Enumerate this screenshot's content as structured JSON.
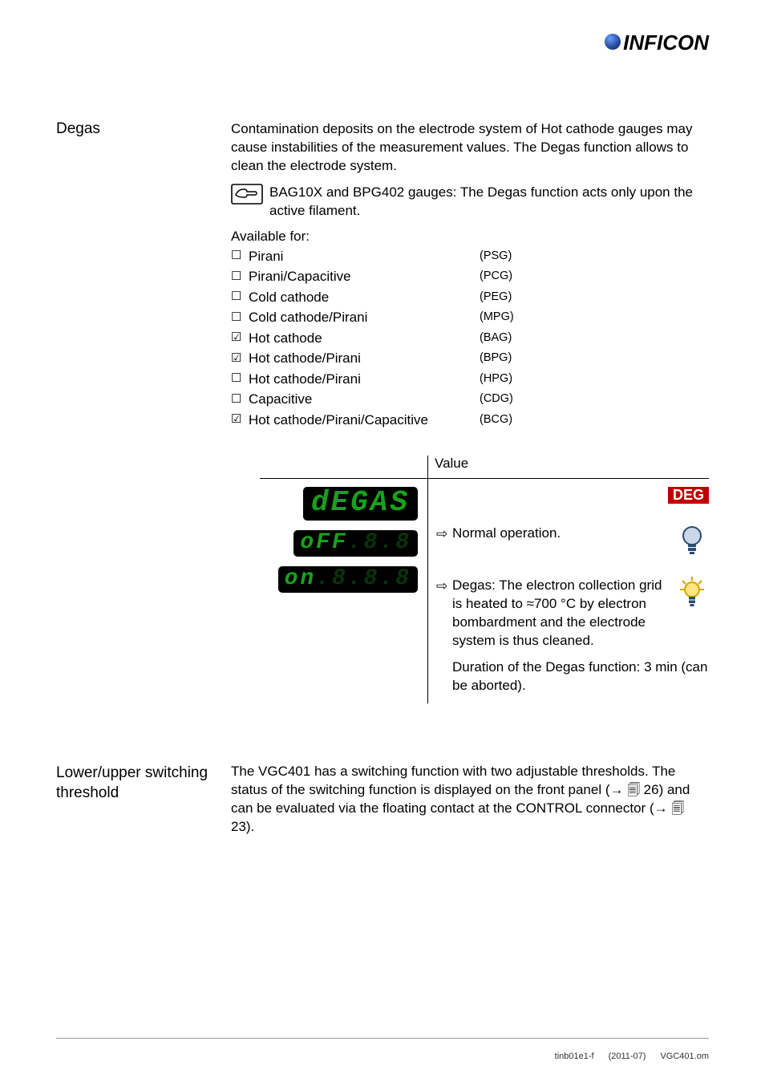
{
  "logo": "INFICON",
  "degas": {
    "heading": "Degas",
    "para1": "Contamination deposits on the electrode system of Hot cathode gauges may cause instabilities of the measurement values. The Degas function allows to clean the electrode system.",
    "tip": "BAG10X and BPG402 gauges: The Degas function acts only upon the active filament.",
    "available_label": "Available for:",
    "gauges": [
      {
        "check": "☐",
        "name": "Pirani",
        "code": "(PSG)"
      },
      {
        "check": "☐",
        "name": "Pirani/Capacitive",
        "code": "(PCG)"
      },
      {
        "check": "☐",
        "name": "Cold cathode",
        "code": "(PEG)"
      },
      {
        "check": "☐",
        "name": "Cold cathode/Pirani",
        "code": "(MPG)"
      },
      {
        "check": "☑",
        "name": "Hot cathode",
        "code": "(BAG)"
      },
      {
        "check": "☑",
        "name": "Hot cathode/Pirani",
        "code": "(BPG)"
      },
      {
        "check": "☐",
        "name": "Hot cathode/Pirani",
        "code": "(HPG)"
      },
      {
        "check": "☐",
        "name": "Capacitive",
        "code": "(CDG)"
      },
      {
        "check": "☑",
        "name": "Hot cathode/Pirani/Capacitive",
        "code": "(BCG)"
      }
    ],
    "value_header": "Value",
    "seg_main": "dEGAS",
    "badge": "DEG",
    "seg_off": "oFF",
    "off_text": "Normal operation.",
    "seg_on": "on",
    "on_text": "Degas: The electron collection grid is heated to ≈700 °C by electron bombardment and the electrode system is thus cleaned.",
    "duration": "Duration of the Degas function: 3 min (can be aborted)."
  },
  "threshold": {
    "heading": "Lower/upper switching threshold",
    "text_a": "The VGC401 has a switching function with two adjustable thresholds. The status of the switching function is displayed on the front panel (→ ",
    "page1": "26",
    "text_b": ") and can be evaluated via the floating contact at the CONTROL connector (→ ",
    "page2": "23",
    "text_c": ")."
  },
  "footer": {
    "left": "tinb01e1-f",
    "mid": "(2011-07)",
    "right": "VGC401.om"
  },
  "icons": {
    "hand": "hand-point-icon",
    "bulb_off": "bulb-off-icon",
    "bulb_on": "bulb-on-icon",
    "page": "page-ref-icon"
  }
}
